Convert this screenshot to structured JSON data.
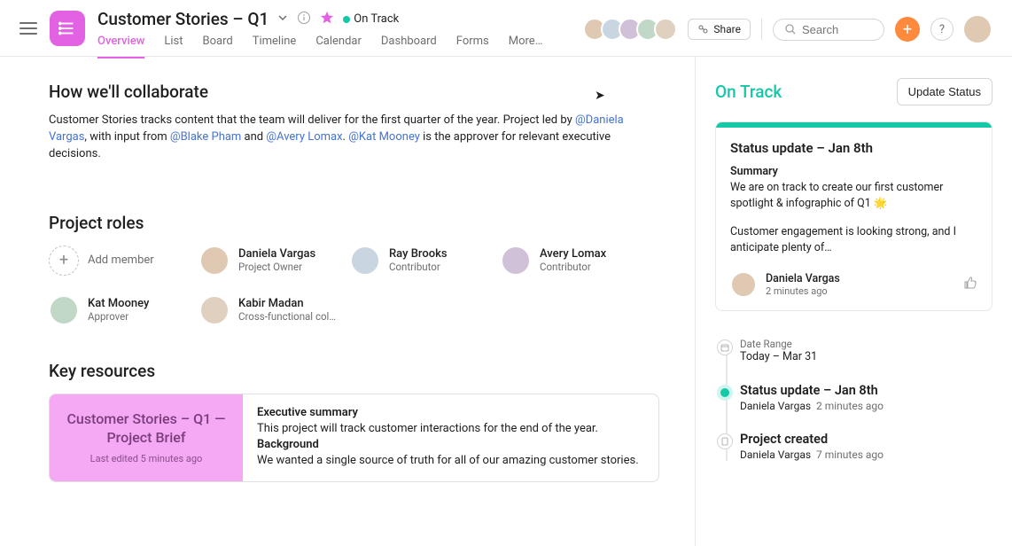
{
  "header": {
    "project_title": "Customer Stories – Q1",
    "status_label": "On Track",
    "tabs": [
      "Overview",
      "List",
      "Board",
      "Timeline",
      "Calendar",
      "Dashboard",
      "Forms",
      "More…"
    ],
    "active_tab": 0,
    "share_label": "Share",
    "search_placeholder": "Search"
  },
  "collab": {
    "heading": "How we'll collaborate",
    "text_pre": "Customer Stories tracks content that the team will deliver for the first quarter of the year. Project led by ",
    "mention1": "@Daniela Vargas",
    "text_mid1": ", with input from ",
    "mention2": "@Blake Pham",
    "text_and": " and ",
    "mention3": "@Avery Lomax",
    "text_period": ". ",
    "mention4": "@Kat Mooney",
    "text_post": " is the approver for relevant executive decisions."
  },
  "roles": {
    "heading": "Project roles",
    "add_label": "Add member",
    "members": [
      {
        "name": "Daniela Vargas",
        "role": "Project Owner"
      },
      {
        "name": "Ray Brooks",
        "role": "Contributor"
      },
      {
        "name": "Avery Lomax",
        "role": "Contributor"
      },
      {
        "name": "Kat Mooney",
        "role": "Approver"
      },
      {
        "name": "Kabir Madan",
        "role": "Cross-functional col…"
      }
    ]
  },
  "key_resources": {
    "heading": "Key resources",
    "brief_title": "Customer Stories – Q1 — Project Brief",
    "brief_sub": "Last edited 5 minutes ago",
    "exec_label": "Executive summary",
    "exec_text": "This project will track customer interactions for the end of the year.",
    "bg_label": "Background",
    "bg_text": "We wanted a single source of truth for all of our amazing customer stories."
  },
  "right_panel": {
    "status_title": "On Track",
    "update_label": "Update Status",
    "card_title": "Status update – Jan 8th",
    "summary_label": "Summary",
    "summary_text": "We are on track to create our first customer spotlight & infographic of Q1 🌟",
    "body_text": "Customer engagement is looking strong, and I anticipate plenty of…",
    "author_name": "Daniela Vargas",
    "author_time": "2 minutes ago",
    "timeline": {
      "date_label": "Date Range",
      "date_value": "Today – Mar 31",
      "item1_title": "Status update – Jan 8th",
      "item1_name": "Daniela Vargas",
      "item1_time": "2 minutes ago",
      "item2_title": "Project created",
      "item2_name": "Daniela Vargas",
      "item2_time": "7 minutes ago"
    }
  }
}
